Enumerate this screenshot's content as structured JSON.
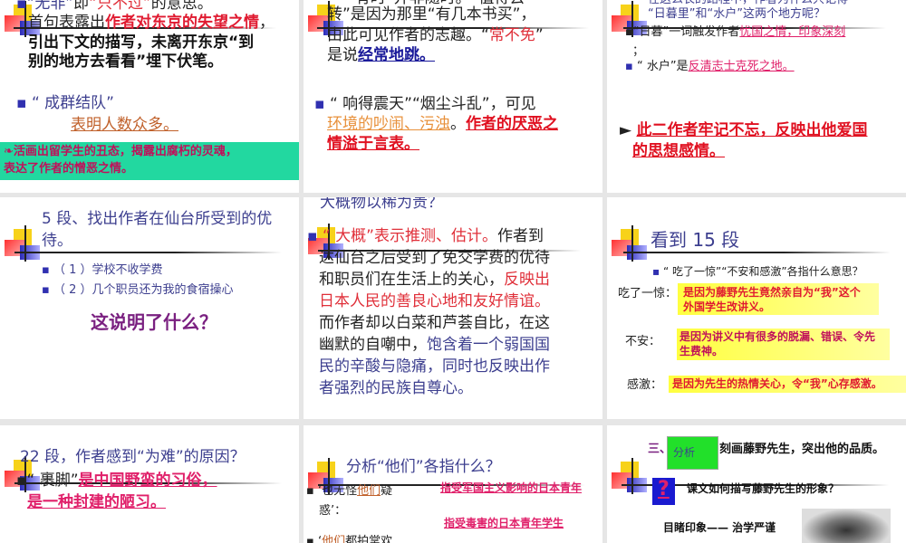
{
  "slides": [
    {
      "lines": [
        {
          "segs": [
            {
              "t": "▪",
              "c": "bullet"
            },
            {
              "t": "“无非”",
              "c": "blue"
            },
            {
              "t": "即",
              "c": "blk"
            },
            {
              "t": "“只不过”",
              "c": "red"
            },
            {
              "t": "的意思。",
              "c": "blk"
            }
          ]
        },
        {
          "segs": [
            {
              "t": "首句表露出",
              "c": "blk"
            },
            {
              "t": "作者对东京的失望之情",
              "c": "hl"
            },
            {
              "t": "，",
              "c": "blk"
            }
          ]
        },
        {
          "segs": [
            {
              "t": "引出下文的描写，未离开东京“到",
              "c": "bk"
            }
          ]
        },
        {
          "segs": [
            {
              "t": "别的地方去看看”埋下伏笔。",
              "c": "bk"
            }
          ]
        },
        {
          "segs": [
            {
              "t": "▪ ",
              "c": "bullet"
            },
            {
              "t": "“ 成群结队”",
              "c": "blue"
            }
          ]
        },
        {
          "segs": [
            {
              "t": "表明人数众多。",
              "c": "brn"
            }
          ]
        },
        {
          "segs": [
            {
              "t": "❧活画出留学生的丑态，揭露出腐朽的灵魂，",
              "c": "dkred"
            }
          ]
        },
        {
          "segs": [
            {
              "t": "表达了作者的憎恶之情。",
              "c": "dkred"
            }
          ]
        }
      ]
    },
    {
      "lines": [
        {
          "segs": [
            {
              "t": "“有时”并非随时。“值得去",
              "c": "blk"
            }
          ]
        },
        {
          "segs": [
            {
              "t": "转”是因为那里“有几本书买”，",
              "c": "blk"
            }
          ]
        },
        {
          "segs": [
            {
              "t": "由此可见作者的志趣。“",
              "c": "blk"
            },
            {
              "t": "常不免",
              "c": "red"
            },
            {
              "t": "”",
              "c": "blk"
            }
          ]
        },
        {
          "segs": [
            {
              "t": "是说",
              "c": "blk"
            },
            {
              "t": "经常地跳。",
              "c": "navy"
            }
          ]
        },
        {
          "segs": [
            {
              "t": "▪ ",
              "c": "bullet"
            },
            {
              "t": "“ 响得震天”“烟尘斗乱”，可见",
              "c": "blk"
            }
          ]
        },
        {
          "segs": [
            {
              "t": "环境的吵闹、污浊",
              "c": "org"
            },
            {
              "t": "。",
              "c": "blk"
            },
            {
              "t": "作者的厌恶之",
              "c": "redb"
            }
          ]
        },
        {
          "segs": [
            {
              "t": "情溢于言表。",
              "c": "redb"
            }
          ]
        }
      ]
    },
    {
      "lines": [
        {
          "segs": [
            {
              "t": "在这么长的路程中，作者为什么只记得",
              "c": "blue"
            }
          ]
        },
        {
          "segs": [
            {
              "t": "“日暮里”和“水户”这两个地方呢？",
              "c": "blue"
            }
          ]
        },
        {
          "segs": [
            {
              "t": "▪“日暮”一词触发作者",
              "c": "blk"
            },
            {
              "t": "忧国之情，印象深刻",
              "c": "mag"
            }
          ]
        },
        {
          "segs": [
            {
              "t": "；",
              "c": "blk"
            }
          ]
        },
        {
          "segs": [
            {
              "t": "▪ ",
              "c": "bullet"
            },
            {
              "t": "“ 水户”是",
              "c": "blk"
            },
            {
              "t": "反清志士克死之地。",
              "c": "mag"
            }
          ]
        },
        {
          "segs": [
            {
              "t": "► ",
              "c": "blk"
            },
            {
              "t": "此二作者牢记不忘，反映出他爱国",
              "c": "redb"
            }
          ]
        },
        {
          "segs": [
            {
              "t": "的思想感情。",
              "c": "redb"
            }
          ]
        }
      ]
    },
    {
      "lines": [
        {
          "segs": [
            {
              "t": "5 段、找出作者在仙台所受到的优",
              "c": "blue"
            }
          ]
        },
        {
          "segs": [
            {
              "t": "待。",
              "c": "blue"
            }
          ]
        },
        {
          "segs": [
            {
              "t": "▪ ",
              "c": "bullet"
            },
            {
              "t": "（ 1 ）学校不收学费",
              "c": "blue"
            }
          ]
        },
        {
          "segs": [
            {
              "t": "▪ ",
              "c": "bullet"
            },
            {
              "t": "（ 2 ）几个职员还为我的食宿操心",
              "c": "blue"
            }
          ]
        },
        {
          "segs": [
            {
              "t": "这说明了什么？",
              "c": "pur"
            }
          ]
        }
      ]
    },
    {
      "lines": [
        {
          "segs": [
            {
              "t": "大概物以稀为贵？",
              "c": "blue"
            }
          ]
        },
        {
          "segs": [
            {
              "t": "▪ ",
              "c": "bullet"
            },
            {
              "t": "“ 大概”表示推测、估计。",
              "c": "red"
            },
            {
              "t": "作者到",
              "c": "blk"
            }
          ]
        },
        {
          "segs": [
            {
              "t": "达仙台之后受到了免交学费的优待",
              "c": "blk"
            }
          ]
        },
        {
          "segs": [
            {
              "t": "和职员们在生活上的关心，",
              "c": "blk"
            },
            {
              "t": "反映出",
              "c": "red"
            }
          ]
        },
        {
          "segs": [
            {
              "t": "日本人民的善良心地和友好情谊。",
              "c": "red"
            }
          ]
        },
        {
          "segs": [
            {
              "t": "而作者却以白菜和芦荟自比，在这",
              "c": "blk"
            }
          ]
        },
        {
          "segs": [
            {
              "t": "幽默的自嘲中，",
              "c": "blk"
            },
            {
              "t": "饱含着一个弱国国",
              "c": "blue"
            }
          ]
        },
        {
          "segs": [
            {
              "t": "民的辛酸与隐痛，同时也反映出作",
              "c": "blue"
            }
          ]
        },
        {
          "segs": [
            {
              "t": "者强烈的民族自尊心。",
              "c": "blue"
            }
          ]
        }
      ]
    },
    {
      "lines": [
        {
          "segs": [
            {
              "t": "看到 15 段",
              "c": "blue"
            }
          ]
        },
        {
          "segs": [
            {
              "t": "▪ ",
              "c": "bullet"
            },
            {
              "t": "“ 吃了一惊”“不安和感激”各指什么意思？",
              "c": "blk"
            }
          ]
        },
        {
          "segs": [
            {
              "t": "吃了一惊：",
              "c": "blk"
            }
          ]
        },
        {
          "segs": [
            {
              "t": "是因为藤野先生竟然亲自为“我”这个",
              "c": "hl"
            }
          ]
        },
        {
          "segs": [
            {
              "t": "外国学生改讲义。",
              "c": "hl"
            }
          ]
        },
        {
          "segs": [
            {
              "t": "不安：",
              "c": "blk"
            }
          ]
        },
        {
          "segs": [
            {
              "t": "是因为讲义中有很多的脱漏、错误、令先",
              "c": "dkred"
            }
          ]
        },
        {
          "segs": [
            {
              "t": "生费神。",
              "c": "dkred"
            }
          ]
        },
        {
          "segs": [
            {
              "t": "感激：",
              "c": "blk"
            }
          ]
        },
        {
          "segs": [
            {
              "t": "是因为先生的热情关心，令“我”心存感激。",
              "c": "hl"
            }
          ]
        }
      ]
    },
    {
      "lines": [
        {
          "segs": [
            {
              "t": "22 段，作者感到“为难”的原因？",
              "c": "blue"
            }
          ]
        },
        {
          "segs": [
            {
              "t": "▪“ 裹脚”",
              "c": "blk"
            },
            {
              "t": "是中国野蛮的习俗，",
              "c": "magb"
            }
          ]
        },
        {
          "segs": [
            {
              "t": "是一种封建的陋习。",
              "c": "magb"
            }
          ]
        }
      ]
    },
    {
      "lines": [
        {
          "segs": [
            {
              "t": "分析“他们”各指什么？",
              "c": "blue"
            }
          ]
        },
        {
          "segs": [
            {
              "t": "▪ ‘也无怪",
              "c": "blk"
            },
            {
              "t": "他们",
              "c": "brn"
            },
            {
              "t": "疑",
              "c": "blk"
            }
          ]
        },
        {
          "segs": [
            {
              "t": "惑’：",
              "c": "blk"
            }
          ]
        },
        {
          "segs": [
            {
              "t": "指受军国主义影响的日本青年",
              "c": "magb"
            }
          ]
        },
        {
          "segs": [
            {
              "t": "指受毒害的日本青年学生",
              "c": "magb"
            }
          ]
        },
        {
          "segs": [
            {
              "t": "▪ ‘",
              "c": "blk"
            },
            {
              "t": "他们",
              "c": "brn"
            },
            {
              "t": "都拍掌欢",
              "c": "blk"
            }
          ]
        }
      ]
    },
    {
      "lines": [
        {
          "segs": [
            {
              "t": "三、",
              "c": "pur"
            }
          ]
        },
        {
          "segs": [
            {
              "t": "刻画藤野先生，突出他的品质。",
              "c": "bk"
            }
          ]
        },
        {
          "segs": [
            {
              "t": "课文如何描写藤野先生的形象？",
              "c": "bk"
            }
          ]
        },
        {
          "segs": [
            {
              "t": "目睹印象—— 治学严谨",
              "c": "bk"
            }
          ]
        },
        {
          "segs": [
            {
              "t": "分析",
              "c": "blue"
            }
          ]
        },
        {
          "segs": [
            {
              "t": "?",
              "c": "mag"
            }
          ]
        }
      ]
    }
  ]
}
